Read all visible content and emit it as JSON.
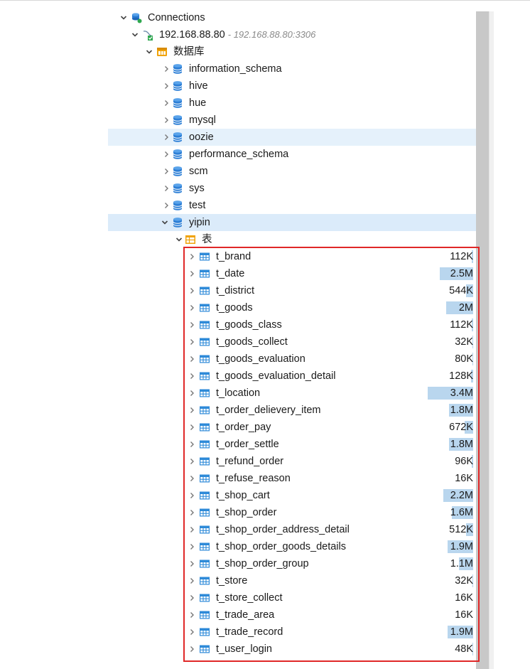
{
  "tree": {
    "connections_label": "Connections",
    "connection": {
      "name": "192.168.88.80",
      "description": "- 192.168.88.80:3306"
    },
    "database_group_label": "数据库",
    "databases": [
      "information_schema",
      "hive",
      "hue",
      "mysql",
      "oozie",
      "performance_schema",
      "scm",
      "sys",
      "test",
      "yipin"
    ],
    "selected_database": "yipin",
    "hovered_database": "oozie",
    "tables_group_label": "表",
    "tables": [
      {
        "name": "t_brand",
        "size": "112K",
        "bar_fraction": 0.03
      },
      {
        "name": "t_date",
        "size": "2.5M",
        "bar_fraction": 0.74
      },
      {
        "name": "t_district",
        "size": "544K",
        "bar_fraction": 0.16
      },
      {
        "name": "t_goods",
        "size": "2M",
        "bar_fraction": 0.59
      },
      {
        "name": "t_goods_class",
        "size": "112K",
        "bar_fraction": 0.03
      },
      {
        "name": "t_goods_collect",
        "size": "32K",
        "bar_fraction": 0.01
      },
      {
        "name": "t_goods_evaluation",
        "size": "80K",
        "bar_fraction": 0.02
      },
      {
        "name": "t_goods_evaluation_detail",
        "size": "128K",
        "bar_fraction": 0.04
      },
      {
        "name": "t_location",
        "size": "3.4M",
        "bar_fraction": 1.0
      },
      {
        "name": "t_order_delievery_item",
        "size": "1.8M",
        "bar_fraction": 0.53
      },
      {
        "name": "t_order_pay",
        "size": "672K",
        "bar_fraction": 0.19
      },
      {
        "name": "t_order_settle",
        "size": "1.8M",
        "bar_fraction": 0.53
      },
      {
        "name": "t_refund_order",
        "size": "96K",
        "bar_fraction": 0.03
      },
      {
        "name": "t_refuse_reason",
        "size": "16K",
        "bar_fraction": 0.005
      },
      {
        "name": "t_shop_cart",
        "size": "2.2M",
        "bar_fraction": 0.65
      },
      {
        "name": "t_shop_order",
        "size": "1.6M",
        "bar_fraction": 0.47
      },
      {
        "name": "t_shop_order_address_detail",
        "size": "512K",
        "bar_fraction": 0.15
      },
      {
        "name": "t_shop_order_goods_details",
        "size": "1.9M",
        "bar_fraction": 0.56
      },
      {
        "name": "t_shop_order_group",
        "size": "1.1M",
        "bar_fraction": 0.32
      },
      {
        "name": "t_store",
        "size": "32K",
        "bar_fraction": 0.01
      },
      {
        "name": "t_store_collect",
        "size": "16K",
        "bar_fraction": 0.005
      },
      {
        "name": "t_trade_area",
        "size": "16K",
        "bar_fraction": 0.005
      },
      {
        "name": "t_trade_record",
        "size": "1.9M",
        "bar_fraction": 0.56
      },
      {
        "name": "t_user_login",
        "size": "48K",
        "bar_fraction": 0.01
      }
    ]
  },
  "colors": {
    "selection": "#dbebfa",
    "hover": "#e5f1fb",
    "size_bar": "#b9d6ee",
    "db_icon": "#2d7fd6",
    "table_icon": "#2e8ad8",
    "folder_icon": "#f0a30a",
    "highlight_box": "#e02828"
  },
  "icons": {
    "connections": "connections-icon",
    "connection": "mysql-connection-icon",
    "database_group": "database-folder-icon",
    "database": "database-icon",
    "tables_group": "tables-folder-icon",
    "table": "table-icon",
    "collapsed": "chevron-right-icon",
    "expanded": "chevron-down-icon"
  }
}
